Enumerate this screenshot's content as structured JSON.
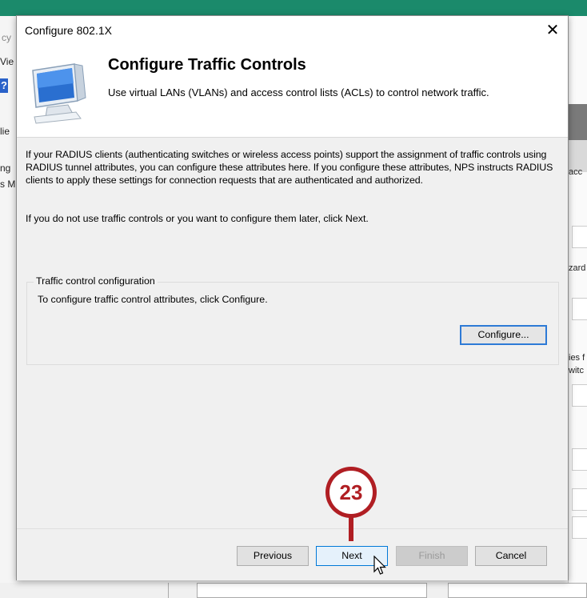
{
  "background": {
    "left_fragments": [
      "cy",
      "Vie",
      "?",
      "lie",
      "ng",
      "s M"
    ],
    "right_fragments": [
      "acc",
      "zard",
      "ies f",
      "witc"
    ],
    "accent_color": "#1b8a6b"
  },
  "dialog": {
    "title": "Configure 802.1X",
    "close_glyph": "✕",
    "header": {
      "title": "Configure Traffic Controls",
      "subtitle": "Use virtual LANs (VLANs) and access control lists (ACLs) to control network traffic."
    },
    "body": {
      "paragraph1": "If your RADIUS clients (authenticating switches or wireless access points) support the assignment of traffic controls using RADIUS tunnel attributes, you can configure these attributes here. If you configure these attributes, NPS instructs RADIUS clients to apply these settings for connection requests that are authenticated and authorized.",
      "paragraph2": "If you do not use traffic controls or you want to configure them later, click Next.",
      "group": {
        "label": "Traffic control configuration",
        "text": "To configure traffic control attributes, click Configure.",
        "configure_label": "Configure..."
      }
    },
    "footer": {
      "previous_label": "Previous",
      "next_label": "Next",
      "finish_label": "Finish",
      "cancel_label": "Cancel"
    }
  },
  "callout": {
    "number": "23",
    "color": "#b01e23"
  }
}
